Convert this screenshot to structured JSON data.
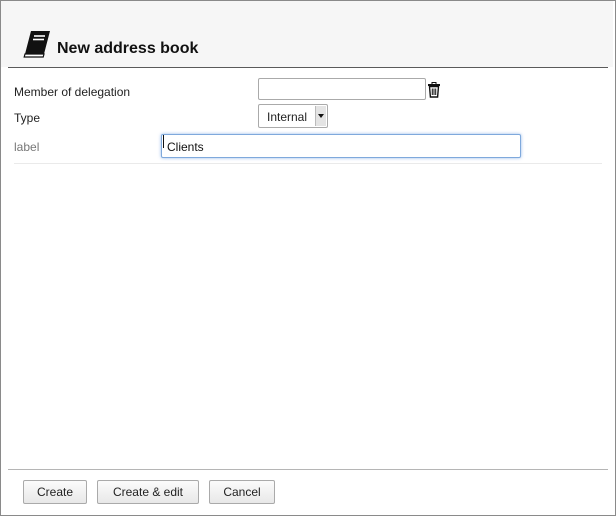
{
  "dialog": {
    "title": "New address book",
    "icon": "address-book-icon"
  },
  "form": {
    "delegation": {
      "label": "Member of delegation",
      "value": "",
      "icon": "trash-icon"
    },
    "type": {
      "label": "Type",
      "selected": "Internal"
    },
    "book_label": {
      "label": "label",
      "value": "Clients"
    }
  },
  "buttons": {
    "create": "Create",
    "create_edit": "Create & edit",
    "cancel": "Cancel"
  },
  "colors": {
    "focus_border": "#7fa9dc",
    "header_bg": "#f6f6f6"
  }
}
